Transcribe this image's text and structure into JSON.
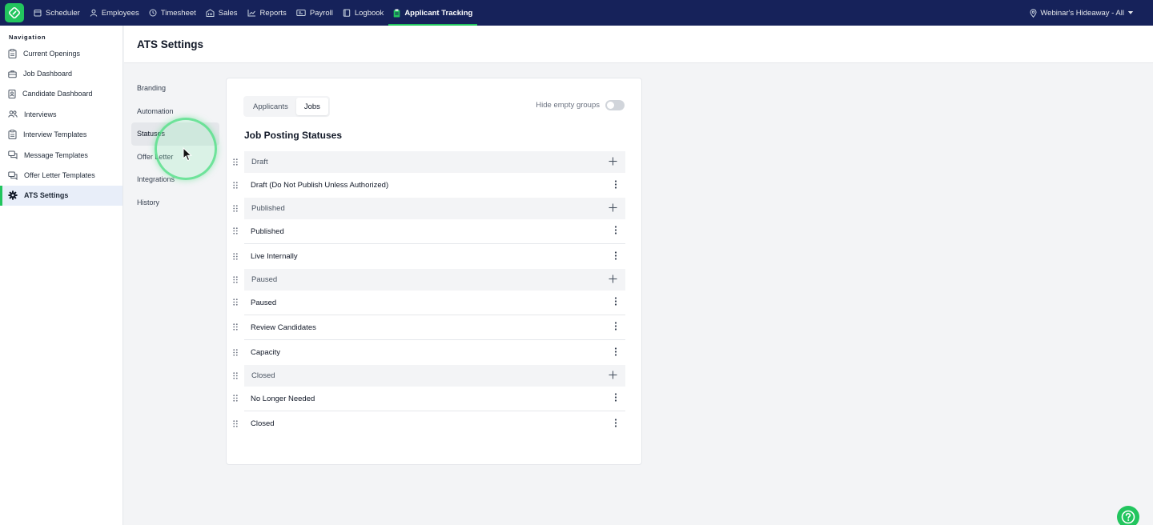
{
  "topbar": {
    "items": [
      {
        "label": "Scheduler",
        "icon": "calendar-icon"
      },
      {
        "label": "Employees",
        "icon": "person-icon"
      },
      {
        "label": "Timesheet",
        "icon": "clock-icon"
      },
      {
        "label": "Sales",
        "icon": "building-icon"
      },
      {
        "label": "Reports",
        "icon": "chart-icon"
      },
      {
        "label": "Payroll",
        "icon": "payroll-icon"
      },
      {
        "label": "Logbook",
        "icon": "book-icon"
      },
      {
        "label": "Applicant Tracking",
        "icon": "clipboard-icon",
        "active": true
      }
    ],
    "location": "Webinar's Hideaway - All"
  },
  "sidebar": {
    "heading": "Navigation",
    "items": [
      {
        "label": "Current Openings",
        "icon": "clipboard-icon"
      },
      {
        "label": "Job Dashboard",
        "icon": "briefcase-icon"
      },
      {
        "label": "Candidate Dashboard",
        "icon": "badge-icon"
      },
      {
        "label": "Interviews",
        "icon": "people-icon"
      },
      {
        "label": "Interview Templates",
        "icon": "clipboard-icon"
      },
      {
        "label": "Message Templates",
        "icon": "messages-icon"
      },
      {
        "label": "Offer Letter Templates",
        "icon": "messages-icon"
      },
      {
        "label": "ATS Settings",
        "icon": "gear-icon",
        "active": true
      }
    ]
  },
  "page": {
    "title": "ATS Settings"
  },
  "subnav": {
    "items": [
      "Branding",
      "Automation",
      "Statuses",
      "Offer Letter",
      "Integrations",
      "History"
    ]
  },
  "card": {
    "tabs": [
      "Applicants",
      "Jobs"
    ],
    "active_tab": "Jobs",
    "hide_empty_label": "Hide empty groups",
    "section_title": "Job Posting Statuses",
    "rows": [
      {
        "type": "group",
        "label": "Draft"
      },
      {
        "type": "item",
        "label": "Draft (Do Not Publish Unless Authorized)"
      },
      {
        "type": "group",
        "label": "Published"
      },
      {
        "type": "item",
        "label": "Published"
      },
      {
        "type": "item",
        "label": "Live Internally"
      },
      {
        "type": "group",
        "label": "Paused"
      },
      {
        "type": "item",
        "label": "Paused"
      },
      {
        "type": "item",
        "label": "Review Candidates"
      },
      {
        "type": "item",
        "label": "Capacity"
      },
      {
        "type": "group",
        "label": "Closed"
      },
      {
        "type": "item",
        "label": "No Longer Needed"
      },
      {
        "type": "item",
        "label": "Closed"
      }
    ]
  },
  "colors": {
    "brand": "#16225a",
    "accent": "#22c55e"
  }
}
